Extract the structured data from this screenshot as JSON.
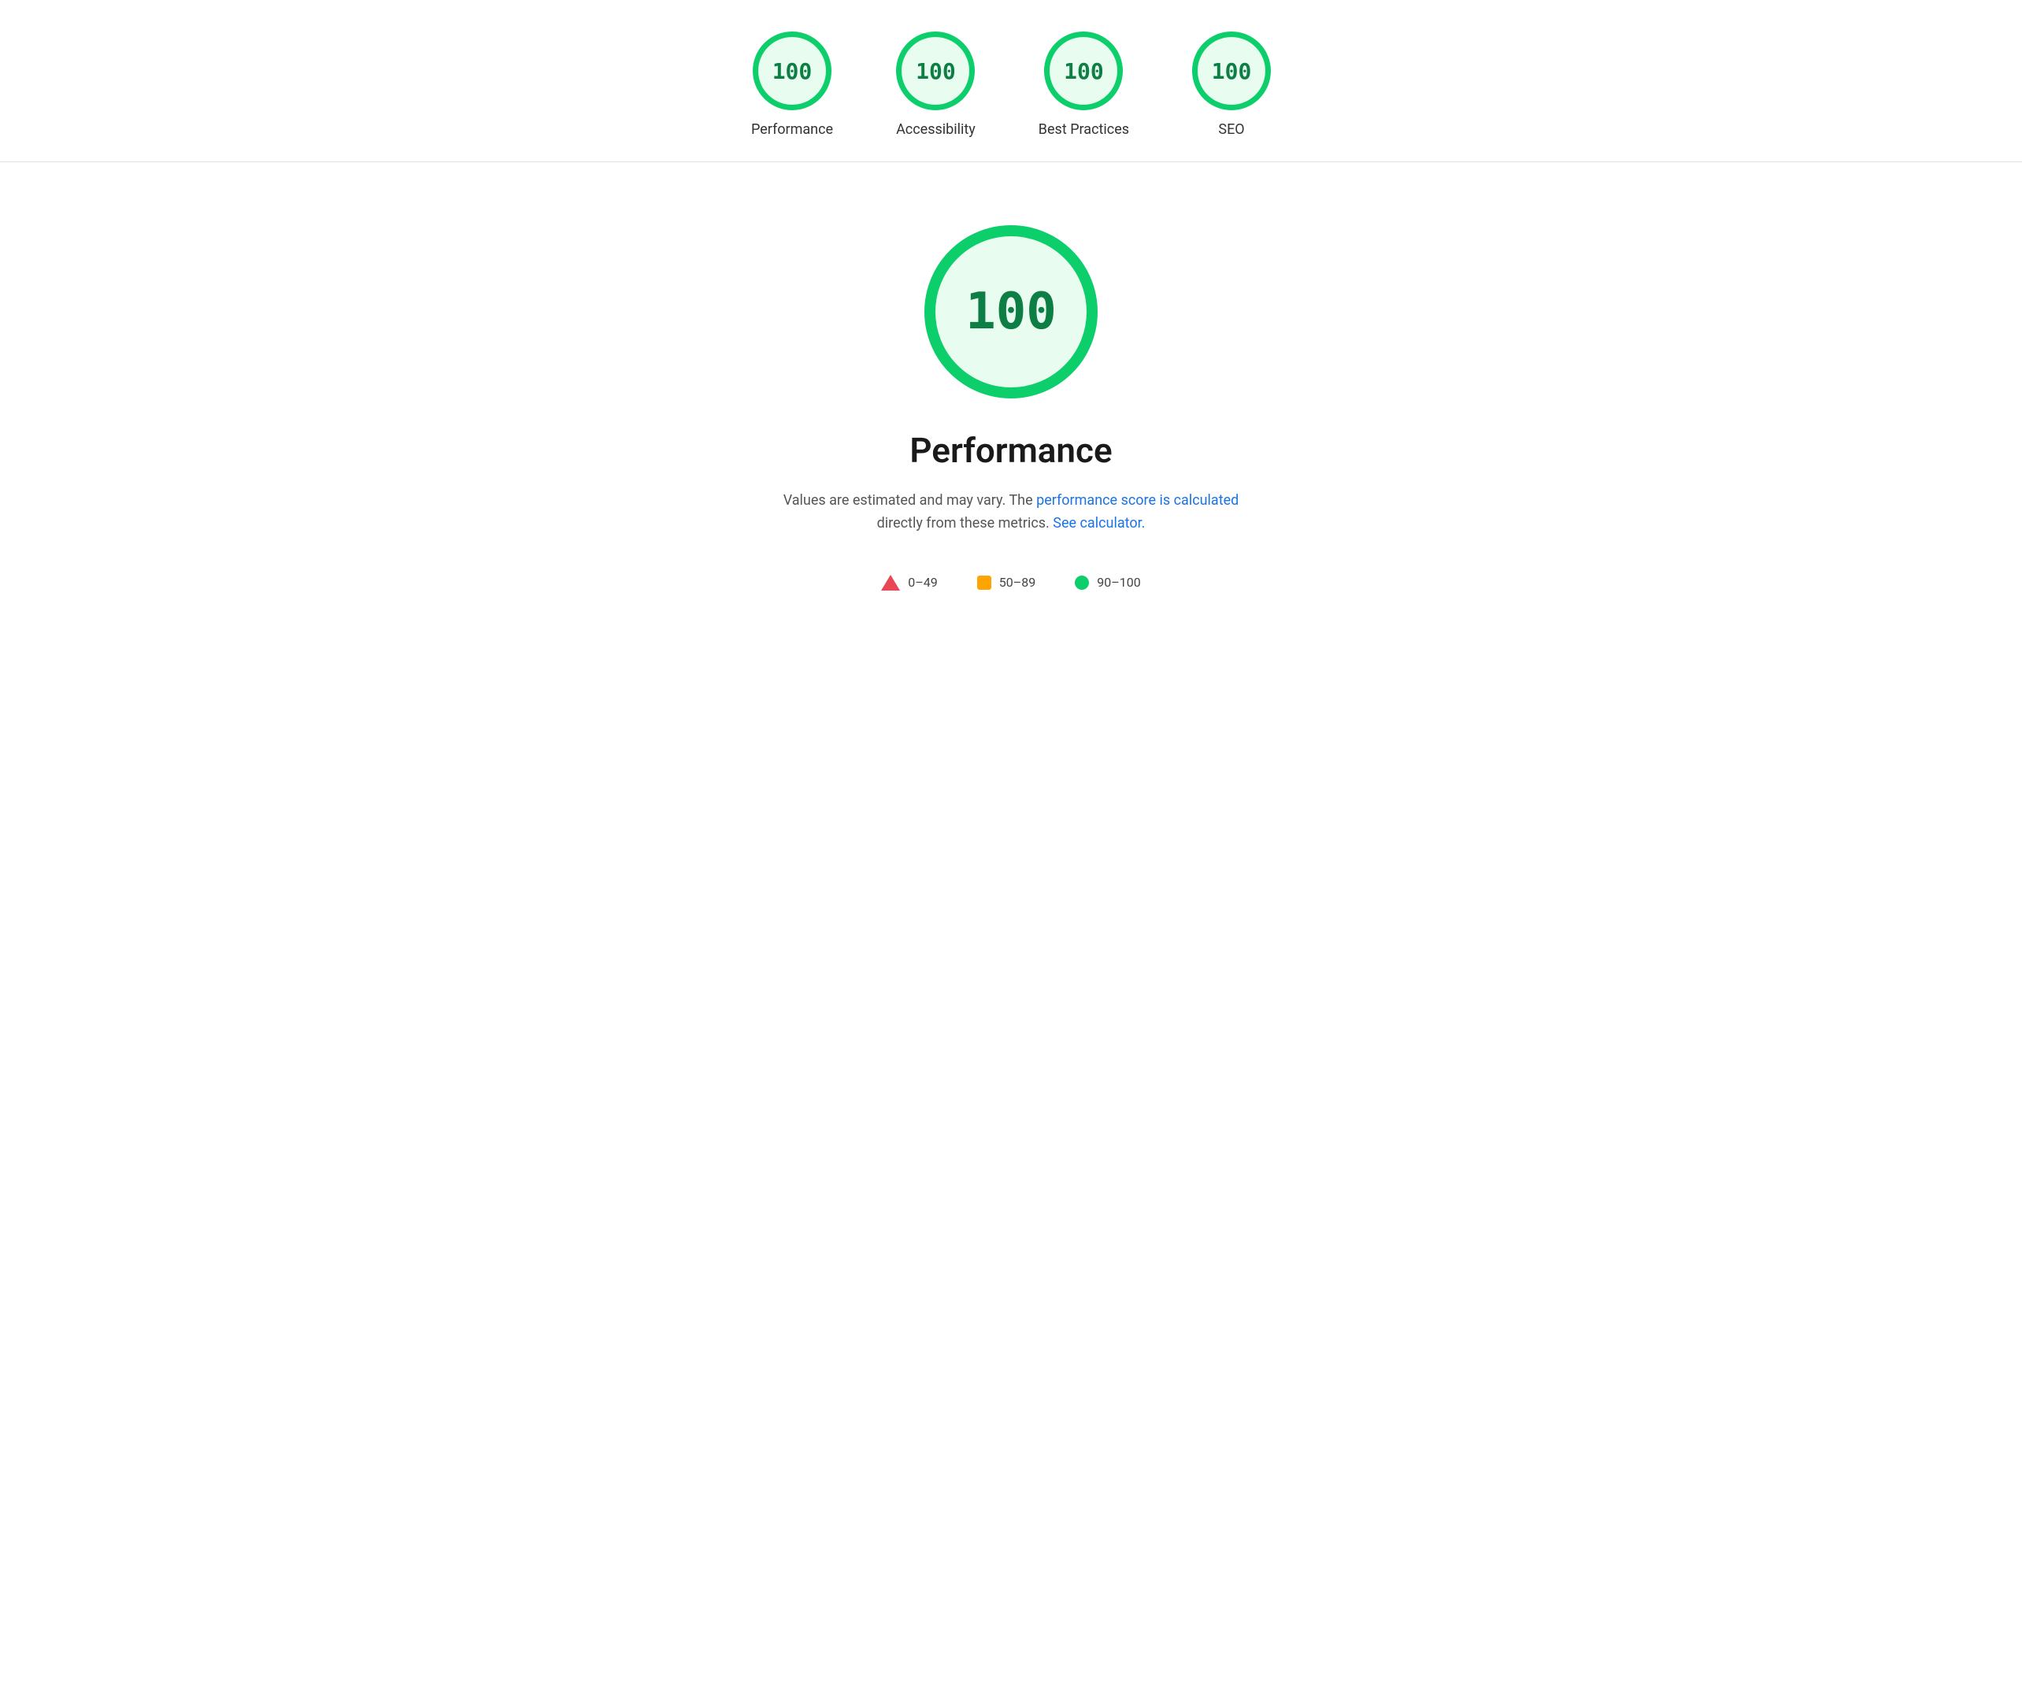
{
  "top_scores": [
    {
      "id": "performance",
      "value": "100",
      "label": "Performance"
    },
    {
      "id": "accessibility",
      "value": "100",
      "label": "Accessibility"
    },
    {
      "id": "best-practices",
      "value": "100",
      "label": "Best Practices"
    },
    {
      "id": "seo",
      "value": "100",
      "label": "SEO"
    }
  ],
  "main": {
    "score": "100",
    "title": "Performance",
    "description_before": "Values are estimated and may vary. The ",
    "link1_text": "performance score is calculated",
    "link1_href": "#",
    "description_middle": " directly from these metrics. ",
    "link2_text": "See calculator.",
    "link2_href": "#"
  },
  "legend": [
    {
      "id": "fail",
      "type": "triangle",
      "range": "0–49"
    },
    {
      "id": "average",
      "type": "square",
      "range": "50–89"
    },
    {
      "id": "pass",
      "type": "circle",
      "range": "90–100"
    }
  ],
  "colors": {
    "green": "#0cce6b",
    "orange": "#ffa400",
    "red": "#e84855",
    "link": "#1a73e8"
  }
}
